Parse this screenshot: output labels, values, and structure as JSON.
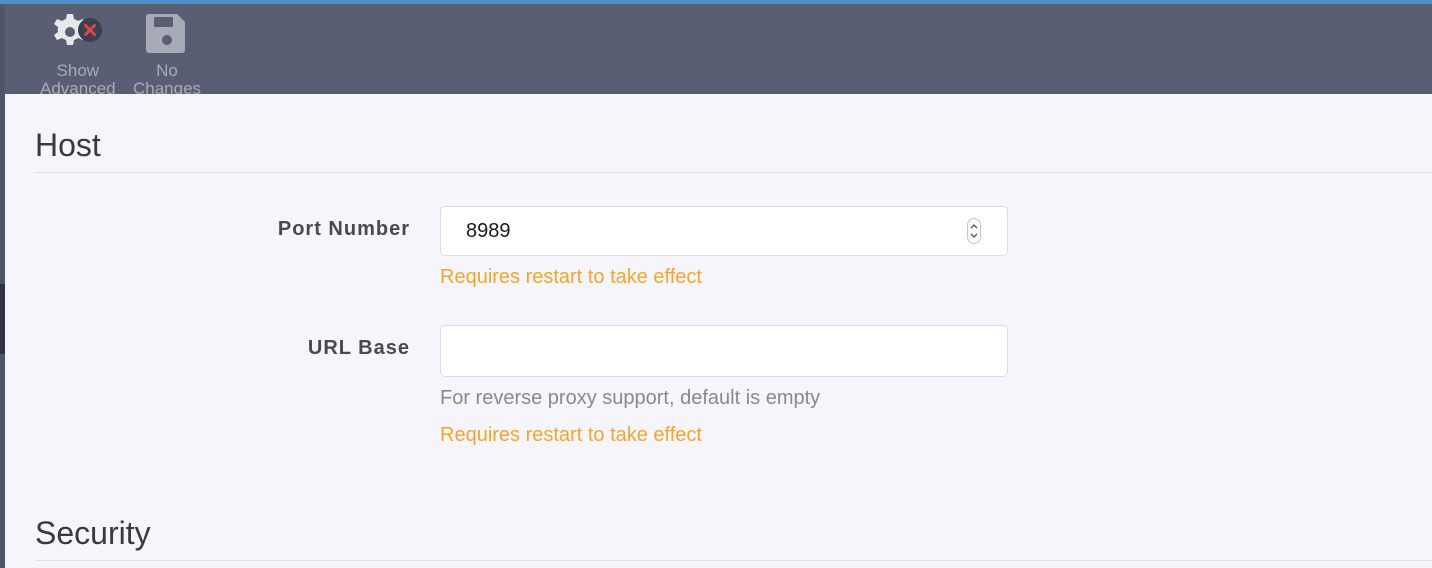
{
  "toolbar": {
    "show_advanced": {
      "line1": "Show",
      "line2": "Advanced",
      "icon": "gear-with-x-icon"
    },
    "no_changes": {
      "line1": "No",
      "line2": "Changes",
      "icon": "save-disk-icon"
    }
  },
  "host": {
    "title": "Host",
    "port": {
      "label": "Port Number",
      "value": "8989",
      "warning": "Requires restart to take effect"
    },
    "url_base": {
      "label": "URL Base",
      "value": "",
      "help": "For reverse proxy support, default is empty",
      "warning": "Requires restart to take effect"
    }
  },
  "security": {
    "title": "Security"
  },
  "colors": {
    "toolbar_bg": "#595e72",
    "content_bg": "#f5f5fb",
    "warning": "#f3a62a",
    "accent": "#4f8fc6",
    "close_badge": "#e0474c"
  }
}
